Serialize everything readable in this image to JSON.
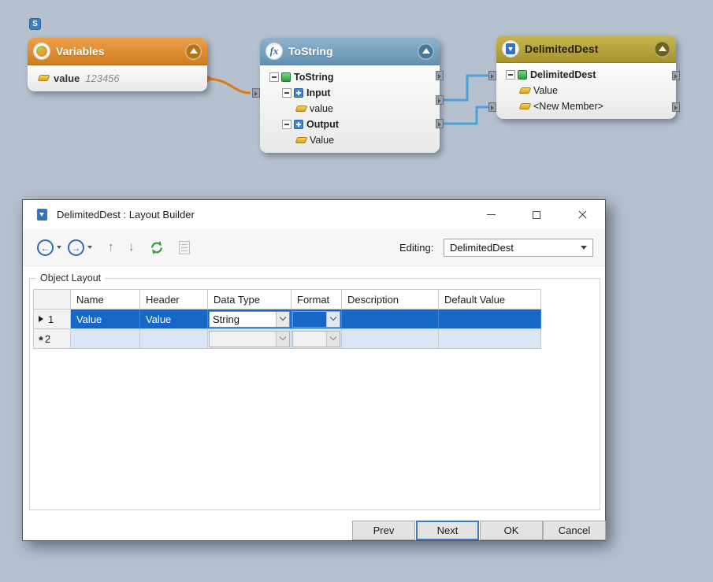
{
  "canvas": {
    "start_badge": "S",
    "variables_node": {
      "title": "Variables",
      "field_name": "value",
      "field_value": "123456"
    },
    "tostring_node": {
      "title": "ToString",
      "root": "ToString",
      "input_group": "Input",
      "input_field": "value",
      "output_group": "Output",
      "output_field": "Value"
    },
    "delimiteddest_node": {
      "title": "DelimitedDest",
      "root": "DelimitedDest",
      "field1": "Value",
      "field2": "<New Member>"
    }
  },
  "dialog": {
    "title": "DelimitedDest : Layout Builder",
    "toolbar": {
      "editing_label": "Editing:",
      "editing_value": "DelimitedDest"
    },
    "group_label": "Object Layout",
    "table": {
      "columns": [
        "Name",
        "Header",
        "Data Type",
        "Format",
        "Description",
        "Default Value"
      ],
      "rows": [
        {
          "num": "1",
          "name": "Value",
          "header": "Value",
          "data_type": "String",
          "format": "",
          "description": "",
          "default_value": "",
          "selected": true
        },
        {
          "num": "2",
          "marker": "*",
          "name": "",
          "header": "",
          "data_type": "",
          "format": "",
          "description": "",
          "default_value": "",
          "new_row": true
        }
      ]
    },
    "buttons": {
      "prev": "Prev",
      "next": "Next",
      "ok": "OK",
      "cancel": "Cancel"
    }
  },
  "colors": {
    "canvas_background": "#b6c1cf",
    "selection_blue": "#1767c8",
    "variables_header": "#d9832b",
    "tostring_header": "#6d9cbd",
    "delimiteddest_header": "#ae9d33",
    "connector_orange": "#e0791c",
    "connector_blue": "#49a3da"
  }
}
